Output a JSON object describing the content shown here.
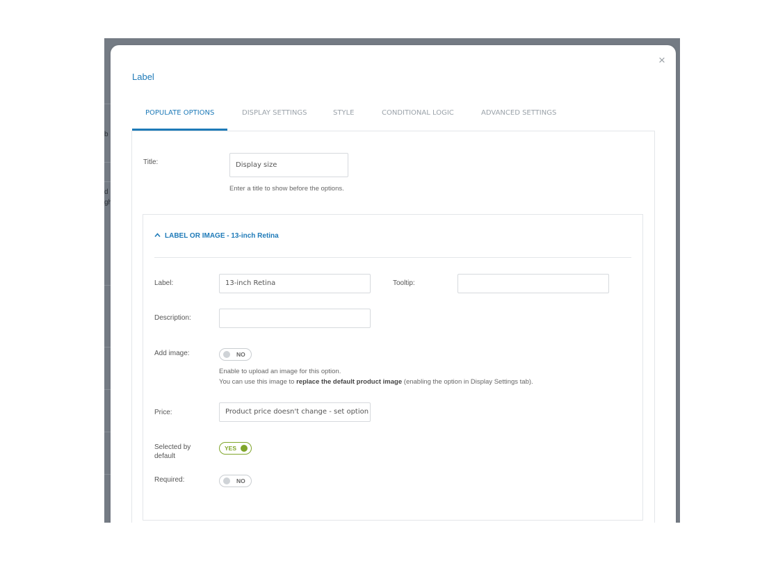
{
  "modal": {
    "title": "Label",
    "close_glyph": "×"
  },
  "tabs": [
    {
      "label": "POPULATE OPTIONS",
      "active": true
    },
    {
      "label": "DISPLAY SETTINGS",
      "active": false
    },
    {
      "label": "STYLE",
      "active": false
    },
    {
      "label": "CONDITIONAL LOGIC",
      "active": false
    },
    {
      "label": "ADVANCED SETTINGS",
      "active": false
    }
  ],
  "title_field": {
    "label": "Title:",
    "value": "Display size",
    "help": "Enter a title to show before the options."
  },
  "option": {
    "header": "LABEL OR IMAGE - 13-inch Retina",
    "chevron_icon": "chevron-up-icon",
    "label_label": "Label:",
    "label_value": "13-inch Retina",
    "tooltip_label": "Tooltip:",
    "tooltip_value": "",
    "description_label": "Description:",
    "description_value": "",
    "add_image_label": "Add image:",
    "add_image_toggle": "NO",
    "add_image_help_1": "Enable to upload an image for this option.",
    "add_image_help_2_pre": "You can use this image to ",
    "add_image_help_2_bold": "replace the default product image",
    "add_image_help_2_post": " (enabling the option in Display Settings tab).",
    "price_label": "Price:",
    "price_placeholder": "Product price doesn't change - set option",
    "selected_label_1": "Selected by",
    "selected_label_2": "default",
    "selected_toggle": "YES",
    "required_label": "Required:",
    "required_toggle": "NO"
  },
  "background_fragments": [
    "b",
    "d",
    "gh"
  ],
  "colors": {
    "accent": "#1e7ab8",
    "toggle_on": "#7fa52a",
    "backdrop": "#747b84"
  }
}
